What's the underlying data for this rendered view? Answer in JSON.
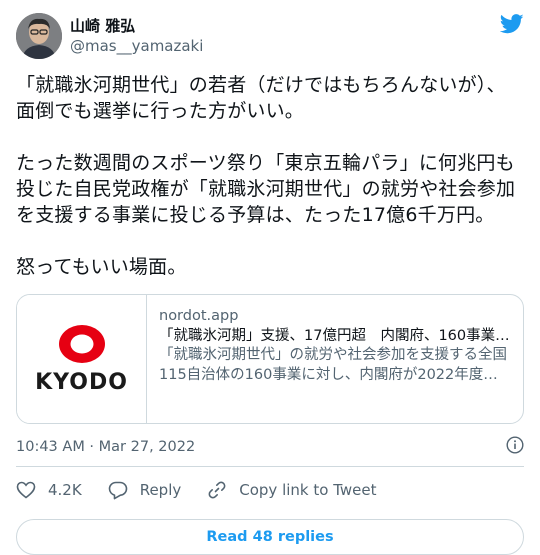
{
  "user": {
    "display_name": "山崎 雅弘",
    "handle": "@mas__yamazaki"
  },
  "tweet": {
    "text": "「就職氷河期世代」の若者（だけではもちろんないが）、面倒でも選挙に行った方がいい。\n\nたった数週間のスポーツ祭り「東京五輪パラ」に何兆円も投じた自民党政権が「就職氷河期世代」の就労や社会参加を支援する事業に投じる予算は、たった17億6千万円。\n\n怒ってもいい場面。"
  },
  "link_card": {
    "logo_text": "KYODO",
    "domain": "nordot.app",
    "title": "「就職氷河期」支援、17億円超　内閣府、160事業…",
    "description": "「就職氷河期世代」の就労や社会参加を支援する全国115自治体の160事業に対し、内閣府が2022年度…"
  },
  "meta": {
    "timestamp": "10:43 AM · Mar 27, 2022"
  },
  "actions": {
    "like_count": "4.2K",
    "reply_label": "Reply",
    "copy_label": "Copy link to Tweet"
  },
  "read_replies_label": "Read 48 replies",
  "colors": {
    "twitter_blue": "#1d9bf0",
    "kyodo_red": "#e60012",
    "secondary_text": "#536471",
    "border": "#cfd9de"
  },
  "icons": [
    "twitter-bird-icon",
    "heart-icon",
    "reply-icon",
    "link-icon",
    "info-icon"
  ]
}
